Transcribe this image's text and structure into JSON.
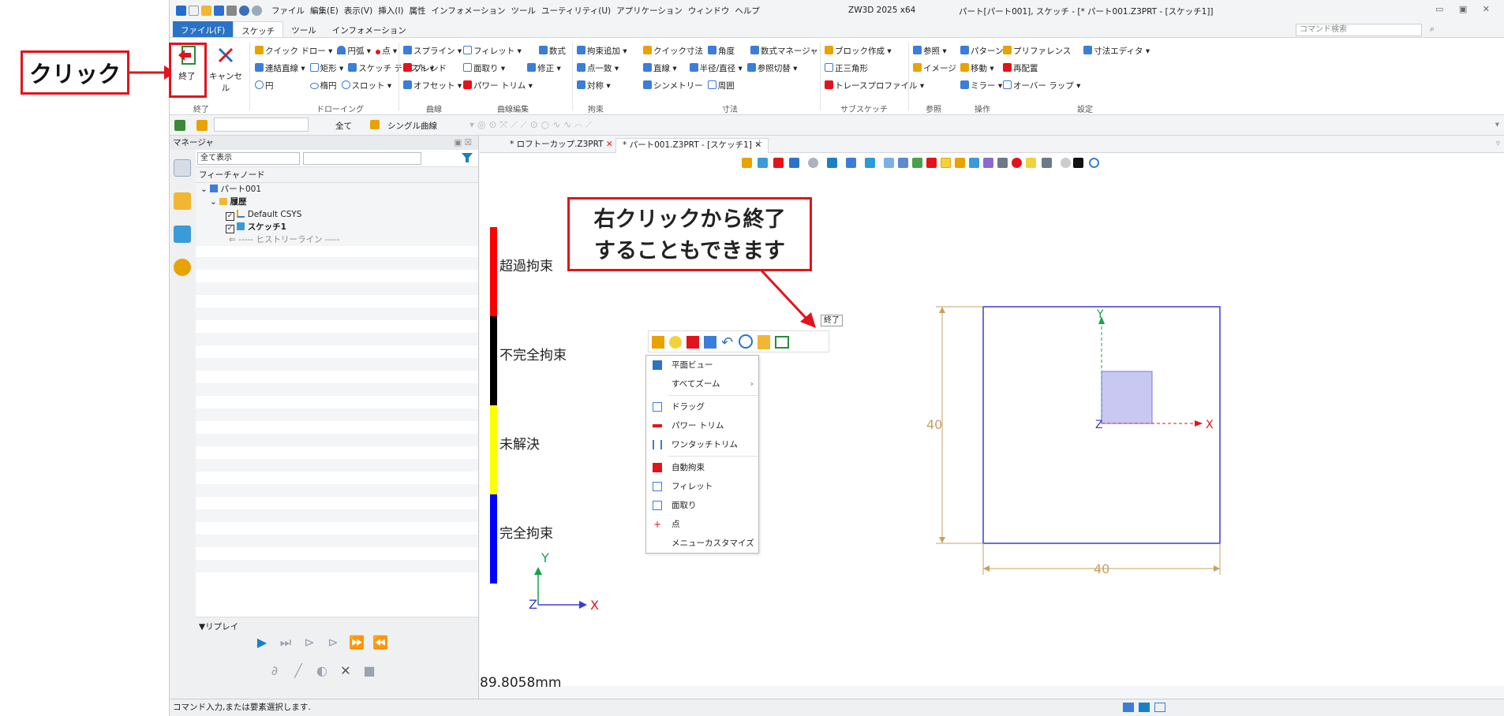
{
  "callout_click": "クリック",
  "callout_right": {
    "line1": "右クリックから終了",
    "line2": "することもできます"
  },
  "title_bar": {
    "menus": [
      "ファイル",
      "編集(E)",
      "表示(V)",
      "挿入(I)",
      "属性",
      "インフォメーション",
      "ツール",
      "ユーティリティ(U)",
      "アプリケーション",
      "ウィンドウ",
      "ヘルプ"
    ],
    "app_title": "ZW3D 2025 x64",
    "doc_title": "パート[パート001], スケッチ - [* パート001.Z3PRT - [スケッチ1]]"
  },
  "ribbon_tabs": {
    "file": "ファイル(F)",
    "sketch": "スケッチ",
    "tools": "ツール",
    "info": "インフォメーション"
  },
  "command_search_placeholder": "コマンド検索",
  "ribbon": {
    "finish": "終了",
    "cancel": "キャンセル",
    "group_finish": "終了",
    "drawing": {
      "row1": [
        "クイック ドロー",
        "円弧",
        "点"
      ],
      "row2": [
        "連結直線",
        "矩形",
        "スケッチ テキスト"
      ],
      "row3": [
        "円",
        "楕円",
        "スロット"
      ],
      "label": "ドローイング"
    },
    "curve": {
      "row1": "スプライン",
      "row2": "ブレンド",
      "row3": "オフセット",
      "label": "曲線"
    },
    "curve_edit": {
      "row1": [
        "フィレット",
        "数式"
      ],
      "row2": [
        "面取り",
        "修正"
      ],
      "row3": [
        "パワー トリム"
      ],
      "label": "曲線編集"
    },
    "constraint": {
      "row1": "拘束追加",
      "row2": "点一致",
      "row3": "対称",
      "label": "拘束"
    },
    "dimension": {
      "row1": [
        "クイック寸法",
        "角度",
        "数式マネージャ"
      ],
      "row2": [
        "直線",
        "半径/直径",
        "参照切替"
      ],
      "row3": [
        "シンメトリー",
        "周囲"
      ],
      "label": "寸法"
    },
    "subsketch": {
      "row1": "ブロック作成",
      "row2": "正三角形",
      "row3": "トレースプロファイル",
      "label": "サブスケッチ"
    },
    "reference": {
      "row1": "参照",
      "row2": "イメージ",
      "label": "参照"
    },
    "operation": {
      "row1": "パターン",
      "row2": "移動",
      "row3": "ミラー",
      "label": "操作"
    },
    "settings": {
      "row1": [
        "プリファレンス",
        "寸法エディタ"
      ],
      "row2": "再配置",
      "row3": "オーバー ラップ",
      "label": "設定"
    }
  },
  "toolbar2": {
    "all": "全て",
    "single_curve": "シングル曲線"
  },
  "manager": {
    "title": "マネージャ",
    "filter_value": "全て表示",
    "tree_header": "フィーチャノード",
    "nodes": [
      "パート001",
      "履歴",
      "Default CSYS",
      "スケッチ1",
      "----- ヒストリーライン -----"
    ],
    "replay": "▼リプレイ"
  },
  "doc_tabs": [
    "* ロフトーカップ.Z3PRT",
    "* パート001.Z3PRT - [スケッチ1]"
  ],
  "finish_tooltip": "終了",
  "context_menu": [
    "平面ビュー",
    "すべてズーム",
    "ドラッグ",
    "パワー トリム",
    "ワンタッチトリム",
    "自動拘束",
    "フィレット",
    "面取り",
    "点",
    "メニューカスタマイズ"
  ],
  "legend": {
    "items": [
      "超過拘束",
      "不完全拘束",
      "未解決",
      "完全拘束"
    ],
    "colors": [
      "#ff0000",
      "#000000",
      "#ffff00",
      "#0000ff"
    ]
  },
  "sketch": {
    "dim_vertical": "40",
    "dim_horizontal": "40",
    "axis_x": "X",
    "axis_y": "Y",
    "axis_z": "Z"
  },
  "coord_readout": "89.8058mm",
  "status": "コマンド入力,または要素選択します."
}
